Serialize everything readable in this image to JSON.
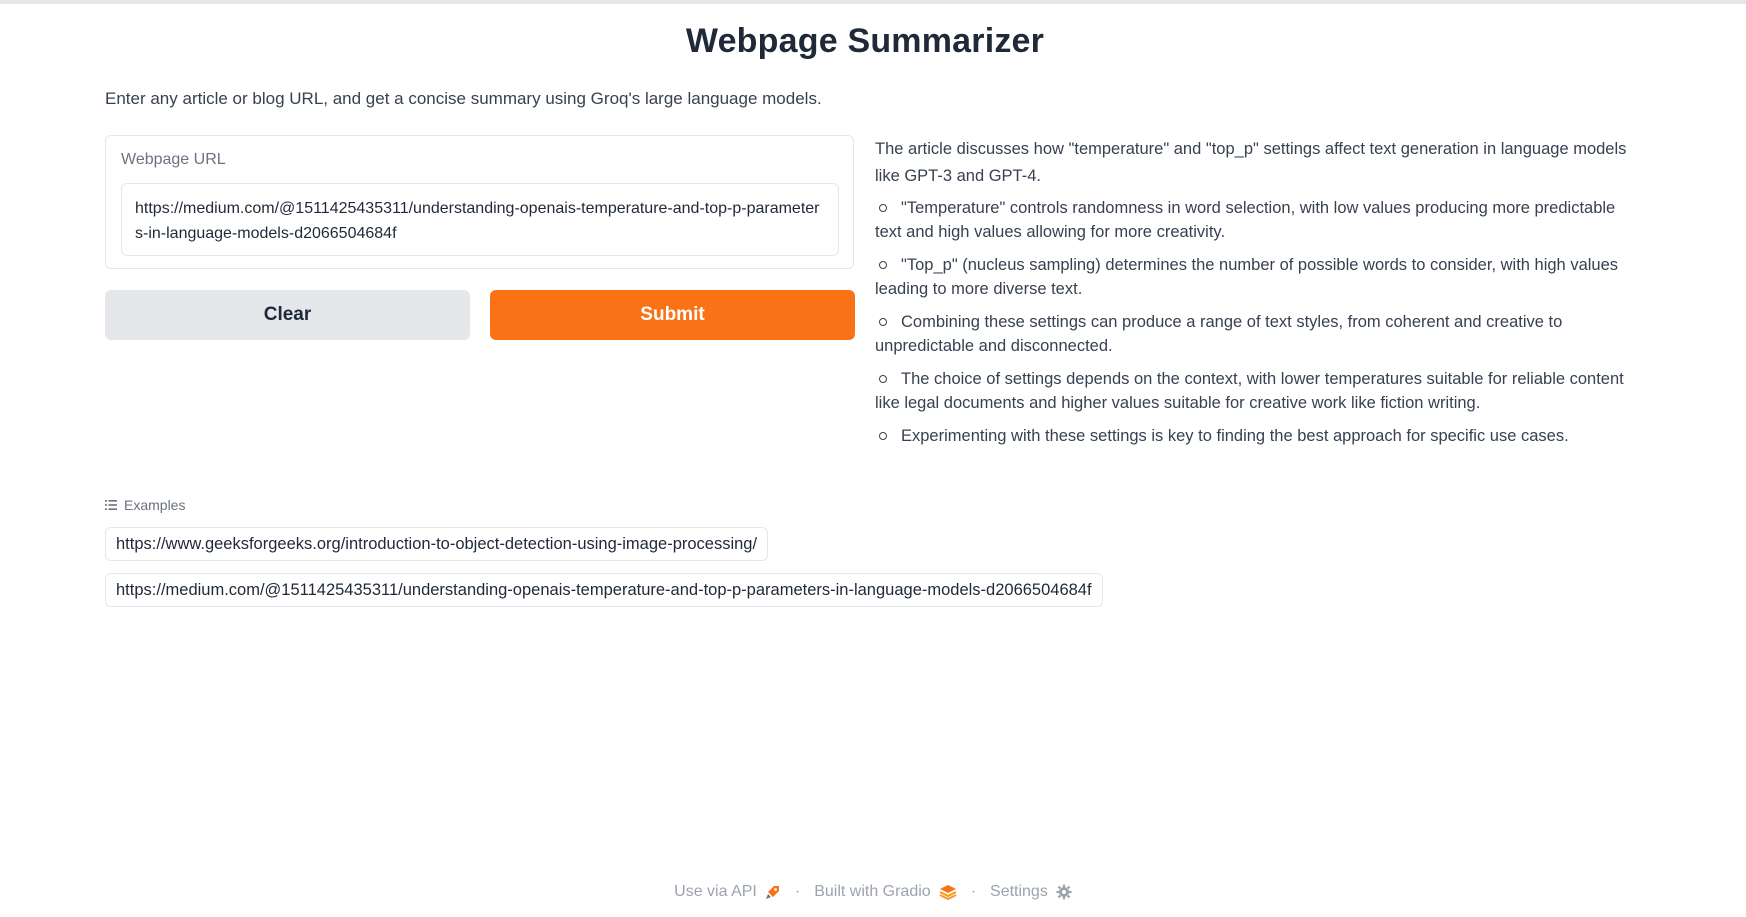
{
  "header": {
    "title": "Webpage Summarizer",
    "description": "Enter any article or blog URL, and get a concise summary using Groq's large language models."
  },
  "input": {
    "label": "Webpage URL",
    "value": "https://medium.com/@1511425435311/understanding-openais-temperature-and-top-p-parameters-in-language-models-d2066504684f"
  },
  "buttons": {
    "clear": "Clear",
    "submit": "Submit"
  },
  "summary": {
    "intro": "The article discusses how \"temperature\" and \"top_p\" settings affect text generation in language models like GPT-3 and GPT-4.",
    "points": [
      "\"Temperature\" controls randomness in word selection, with low values producing more predictable text and high values allowing for more creativity.",
      "\"Top_p\" (nucleus sampling) determines the number of possible words to consider, with high values leading to more diverse text.",
      "Combining these settings can produce a range of text styles, from coherent and creative to unpredictable and disconnected.",
      "The choice of settings depends on the context, with lower temperatures suitable for reliable content like legal documents and higher values suitable for creative work like fiction writing.",
      "Experimenting with these settings is key to finding the best approach for specific use cases."
    ]
  },
  "examples": {
    "label": "Examples",
    "items": [
      "https://www.geeksforgeeks.org/introduction-to-object-detection-using-image-processing/",
      "https://medium.com/@1511425435311/understanding-openais-temperature-and-top-p-parameters-in-language-models-d2066504684f"
    ]
  },
  "footer": {
    "api": "Use via API",
    "built": "Built with Gradio",
    "settings": "Settings",
    "separator": "·"
  },
  "colors": {
    "accent": "#f97316",
    "button_secondary": "#e5e7eb"
  },
  "icons": {
    "api": "rocket-icon",
    "gradio": "gradio-logo-icon",
    "settings": "gear-icon",
    "examples": "list-icon"
  }
}
